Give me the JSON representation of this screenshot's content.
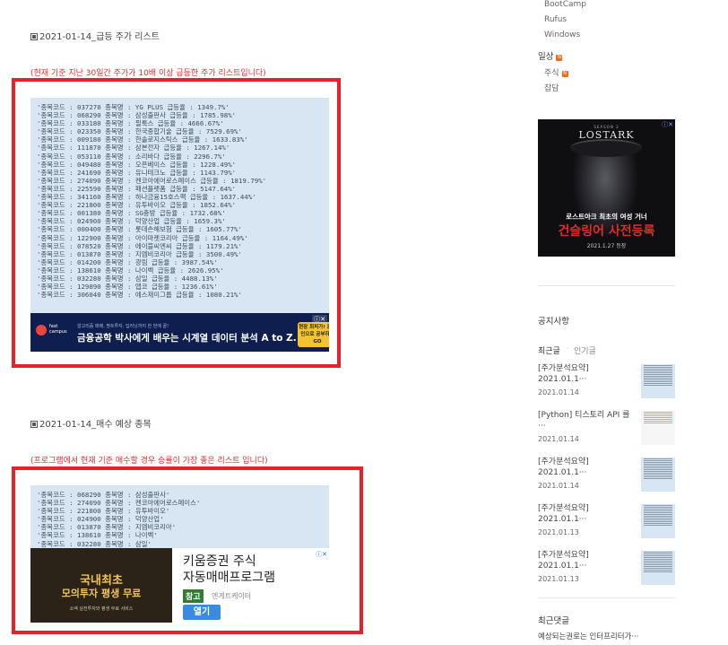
{
  "main": {
    "section1": {
      "title": "2021-01-14_급등 주가 리스트",
      "desc": "(현재 기준 지난 30일간 주가가 10배 이상 급등한 주가 리스트입니다)",
      "lines": [
        "'종목코드 : 037270 종목명 : YG PLUS 급등율 : 1349.7%'",
        "'종목코드 : 068290 종목명 : 삼성출판사 급등율 : 1785.98%'",
        "'종목코드 : 033180 종목명 : 필룩스 급등율 : 4666.67%'",
        "'종목코드 : 023350 종목명 : 한국종합기술 급등율 : 7529.69%'",
        "'종목코드 : 009180 종목명 : 한솔로지스틱스 급등율 : 1633.83%'",
        "'종목코드 : 111870 종목명 : 삼본전자 급등율 : 1267.14%'",
        "'종목코드 : 053110 종목명 : 소리바다 급등율 : 2296.7%'",
        "'종목코드 : 049480 종목명 : 오픈베이스 급등율 : 1228.49%'",
        "'종목코드 : 241690 종목명 : 유니테크노 급등율 : 1143.79%'",
        "'종목코드 : 274090 종목명 : 켄코아에어로스페이스 급등율 : 1819.79%'",
        "'종목코드 : 225590 종목명 : 패션플랫폼 급등율 : 5147.64%'",
        "'종목코드 : 341160 종목명 : 하나금융15호스팩 급등율 : 1637.44%'",
        "'종목코드 : 221800 종목명 : 유투바이오 급등율 : 1852.64%'",
        "'종목코드 : 001380 종목명 : SG충방 급등율 : 1732.68%'",
        "'종목코드 : 024900 종목명 : 덕양산업 급등율 : 1659.3%'",
        "'종목코드 : 000400 종목명 : 롯데손해보험 급등율 : 1605.77%'",
        "'종목코드 : 122900 종목명 : 아이마켓코리아 급등율 : 1164.49%'",
        "'종목코드 : 078520 종목명 : 에이블씨엔씨 급등율 : 1179.21%'",
        "'종목코드 : 013870 종목명 : 지엠비코리아 급등율 : 3500.49%'",
        "'종목코드 : 014200 종목명 : 광림 급등율 : 3987.54%'",
        "'종목코드 : 138610 종목명 : 나이벡 급등율 : 2626.95%'",
        "'종목코드 : 032280 종목명 : 삼일 급등율 : 4488.13%'",
        "'종목코드 : 129890 종목명 : 앱코 급등율 : 1236.61%'",
        "'종목코드 : 306040 종목명 : 에스제이그룹 급등율 : 1080.21%'"
      ],
      "ad": {
        "brand": "fast campus",
        "small": "알고리즘 매매, 퀀트투자, 딥러닝까지 한 번에 끝!",
        "headline": "금융공학 박사에게 배우는 시계열 데이터 분석 A to Z.",
        "cta": "현장 회피가! 온라인으로 공부하기 GO",
        "close": "ⓘ✕"
      }
    },
    "section2": {
      "title": "2021-01-14_매수 예상 종목",
      "desc": "(프로그램에서 현재 기준 매수할 경우 승률이 가장 좋은 리스트 입니다)",
      "lines": [
        "'종목코드 : 068290 종목명 : 삼성출판사'",
        "'종목코드 : 274090 종목명 : 켄코아에어로스페이스'",
        "'종목코드 : 221800 종목명 : 유투바이오'",
        "'종목코드 : 024900 종목명 : 덕양산업'",
        "'종목코드 : 013870 종목명 : 지엠비코리아'",
        "'종목코드 : 138610 종목명 : 나이벡'",
        "'종목코드 : 032280 종목명 : 삼일'"
      ],
      "ad": {
        "banner_line1": "국내최초",
        "banner_line2": "모의투자 평생 무료",
        "banner_small": "소액 실전투자와 평생 무료 서비스",
        "title_line1": "키움증권 주식",
        "title_line2": "자동매매프로그램",
        "tag": "참고",
        "advertiser": "엔게트케이터",
        "button": "열기",
        "close": "ⓘ✕"
      }
    }
  },
  "sidebar": {
    "top_links": [
      "BootCamp",
      "Rufus",
      "Windows"
    ],
    "category": "일상",
    "new_badge": "N",
    "sub_links": [
      "주식",
      "잡담"
    ],
    "lostark": {
      "season": "SEASON 2",
      "logo": "LOSTARK",
      "line1": "로스트아크 최초의 여성 거너",
      "line2": "건슬링어 사전등록",
      "line3": "2021.1.27 등장",
      "close": "ⓘ✕"
    },
    "notice": "공지사항",
    "tabs": [
      "최근글",
      "인기글"
    ],
    "posts": [
      {
        "title": "[주가분석요약] 2021.01.1···",
        "date": "2021.01.14"
      },
      {
        "title": "[Python] 티스토리 API 를···",
        "date": "2021.01.14"
      },
      {
        "title": "[주가분석요약] 2021.01.1···",
        "date": "2021.01.14"
      },
      {
        "title": "[주가분석요약] 2021.01.1···",
        "date": "2021.01.13"
      },
      {
        "title": "[주가분석요약] 2021.01.1···",
        "date": "2021.01.13"
      }
    ],
    "recent_comments": "최근댓글",
    "comment_preview": "예상되는권로는 인터프리터가···"
  }
}
